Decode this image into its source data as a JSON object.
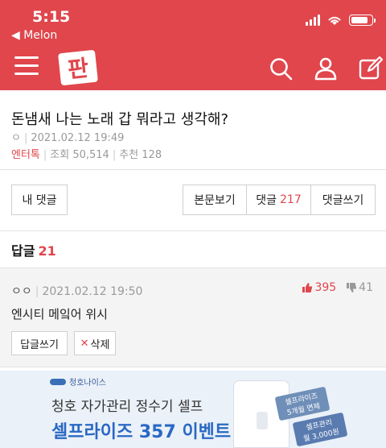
{
  "status_bar": {
    "time": "5:15",
    "back_app": "◀ Melon",
    "battery_level": 0.85
  },
  "header": {
    "logo_text": "판",
    "icons": [
      "menu-icon",
      "search-icon",
      "user-icon",
      "write-icon"
    ],
    "color": "#e0464c"
  },
  "article": {
    "title": "돈냄새 나는 노래 갑 뭐라고 생각해?",
    "author": "ㅇ",
    "date": "2021.02.12 19:49",
    "category": "엔터톡",
    "views": "조회 50,514",
    "recommends": "추천 128"
  },
  "buttons": {
    "my_comments": "내 댓글",
    "view_body": "본문보기",
    "comments_label": "댓글",
    "comments_count": "217",
    "write_comment": "댓글쓰기"
  },
  "replies": {
    "label": "답글",
    "count": "21",
    "items": [
      {
        "author": "ㅇㅇ",
        "date": "2021.02.12 19:50",
        "up": "395",
        "down": "41",
        "text": "엔시티 메잌어 위시",
        "reply_button": "답글쓰기",
        "delete_button": "삭제"
      }
    ]
  },
  "ad": {
    "brand": "청호나이스",
    "line1": "청호 자가관리 정수기 셀프",
    "line2": "셀프라이즈 357 이벤트",
    "tag1_top": "셀프라이즈",
    "tag1_bottom": "5개월 면제",
    "tag2_top": "셀프관리",
    "tag2_bottom": "월 3,000원"
  }
}
